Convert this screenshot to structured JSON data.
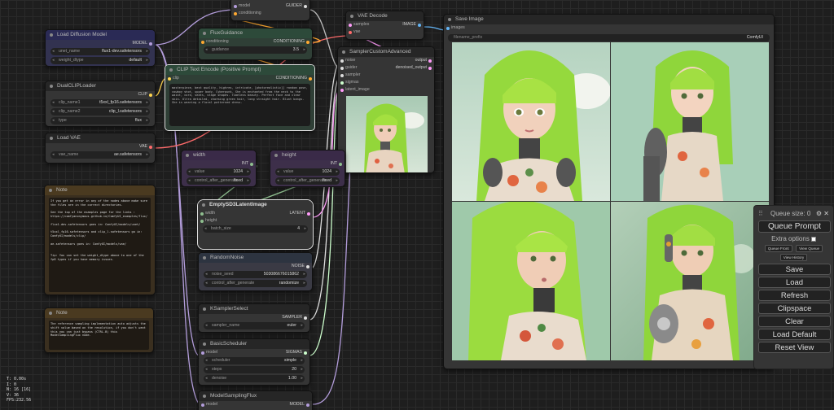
{
  "nodes": {
    "unet_top": {
      "in_model": "model",
      "in_conditioning": "conditioning",
      "out": "GUIDER"
    },
    "vae_decode": {
      "title": "VAE Decode",
      "in_samples": "samples",
      "in_vae": "vae",
      "out": "IMAGE"
    },
    "load_diffusion": {
      "title": "Load Diffusion Model",
      "out": "MODEL",
      "w_unet_label": "unet_name",
      "w_unet_val": "flux1-dev.safetensors",
      "w_dtype_label": "weight_dtype",
      "w_dtype_val": "default"
    },
    "flux_guidance": {
      "title": "FluxGuidance",
      "in": "conditioning",
      "out": "CONDITIONING",
      "w_label": "guidance",
      "w_val": "3.5"
    },
    "sampler_adv": {
      "title": "SamplerCustomAdvanced",
      "in_noise": "noise",
      "in_guider": "guider",
      "in_sampler": "sampler",
      "in_sigmas": "sigmas",
      "in_latent": "latent_image",
      "out_output": "output",
      "out_denoised": "denoised_output"
    },
    "clip_text": {
      "title": "CLIP Text Encode (Positive Prompt)",
      "in": "clip",
      "out": "CONDITIONING",
      "text": "masterpiece, best quality, highres, intricate, [photorealistic]] random pose, cowboy shot, upper body, Cyberpunk. She is enchanted from the neck to the waist, cord, seats, stage shapes. Timeless beauty. Perfect face and clear skin. Ultra detailed, charming green hair, long straight hair. Blunt bangs. She is wearing a floral patterned dress."
    },
    "dual_clip": {
      "title": "DualCLIPLoader",
      "out": "CLIP",
      "w1_label": "clip_name1",
      "w1_val": "t5xxl_fp16.safetensors",
      "w2_label": "clip_name2",
      "w2_val": "clip_l.safetensors",
      "w3_label": "type",
      "w3_val": "flux"
    },
    "load_vae": {
      "title": "Load VAE",
      "out": "VAE",
      "w_label": "vae_name",
      "w_val": "ae.safetensors"
    },
    "width": {
      "title": "width",
      "out": "INT",
      "w1_label": "value",
      "w1_val": "1024",
      "w2_label": "control_after_generate",
      "w2_val": "fixed"
    },
    "height": {
      "title": "height",
      "out": "INT",
      "w1_label": "value",
      "w1_val": "1024",
      "w2_label": "control_after_generate",
      "w2_val": "fixed"
    },
    "empty_latent": {
      "title": "EmptySD3LatentImage",
      "in_width": "width",
      "in_height": "height",
      "out": "LATENT",
      "w_label": "batch_size",
      "w_val": "4"
    },
    "note1": {
      "title": "Note",
      "text": "If you get an error in any of the nodes above make sure the files are in the correct directories.\n\nSee the top of the examples page for the links : https://comfyanonymous.github.io/ComfyUI_examples/flux/\n\nflux1-dev.safetensors goes in: ComfyUI/models/unet/\n\nt5xxl_fp16.safetensors and clip_l.safetensors go in: ComfyUI/models/clip/\n\nae.safetensors goes in: ComfyUI/models/vae/\n\n\nTip: You can set the weight_dtype above to one of the fp8 types if you have memory issues."
    },
    "note2": {
      "title": "Note",
      "text": "The reference sampling implementation auto adjusts the shift value based on the resolution, if you don't want this you can just bypass (CTRL-B) this ModelSamplingFlux node."
    },
    "random_noise": {
      "title": "RandomNoise",
      "out": "NOISE",
      "w1_label": "noise_seed",
      "w1_val": "503086676015862",
      "w2_label": "control_after_generate",
      "w2_val": "randomize"
    },
    "ksampler_select": {
      "title": "KSamplerSelect",
      "out": "SAMPLER",
      "w_label": "sampler_name",
      "w_val": "euler"
    },
    "basic_scheduler": {
      "title": "BasicScheduler",
      "in": "model",
      "out": "SIGMAS",
      "w1_label": "scheduler",
      "w1_val": "simple",
      "w2_label": "steps",
      "w2_val": "20",
      "w3_label": "denoise",
      "w3_val": "1.00"
    },
    "model_sampling": {
      "title": "ModelSamplingFlux",
      "in": "model",
      "out": "MODEL"
    },
    "save_image": {
      "title": "Save Image",
      "in": "images",
      "w_label": "filename_prefix",
      "w_val": "ComfyUI"
    }
  },
  "stats": [
    "T: 0.00s",
    "I: 0",
    "N: 16 [16]",
    "V: 36",
    "FPS:232.56"
  ],
  "queue": {
    "size_label": "Queue size: 0",
    "queue_prompt": "Queue Prompt",
    "extra_options": "Extra options",
    "queue_front": "Queue Front",
    "view_queue": "View Queue",
    "view_history": "View History",
    "save": "Save",
    "load": "Load",
    "refresh": "Refresh",
    "clipspace": "Clipspace",
    "clear": "Clear",
    "load_default": "Load Default",
    "reset_view": "Reset View"
  },
  "colors": {
    "model": "#b39ddb",
    "clip": "#ffd54f",
    "vae": "#ff6b6b",
    "conditioning": "#ffa931",
    "latent": "#ff9cf9",
    "image": "#64b5f6",
    "noise": "#b0b0b0",
    "sigmas": "#cdffcd",
    "int": "#8fbf8f"
  }
}
